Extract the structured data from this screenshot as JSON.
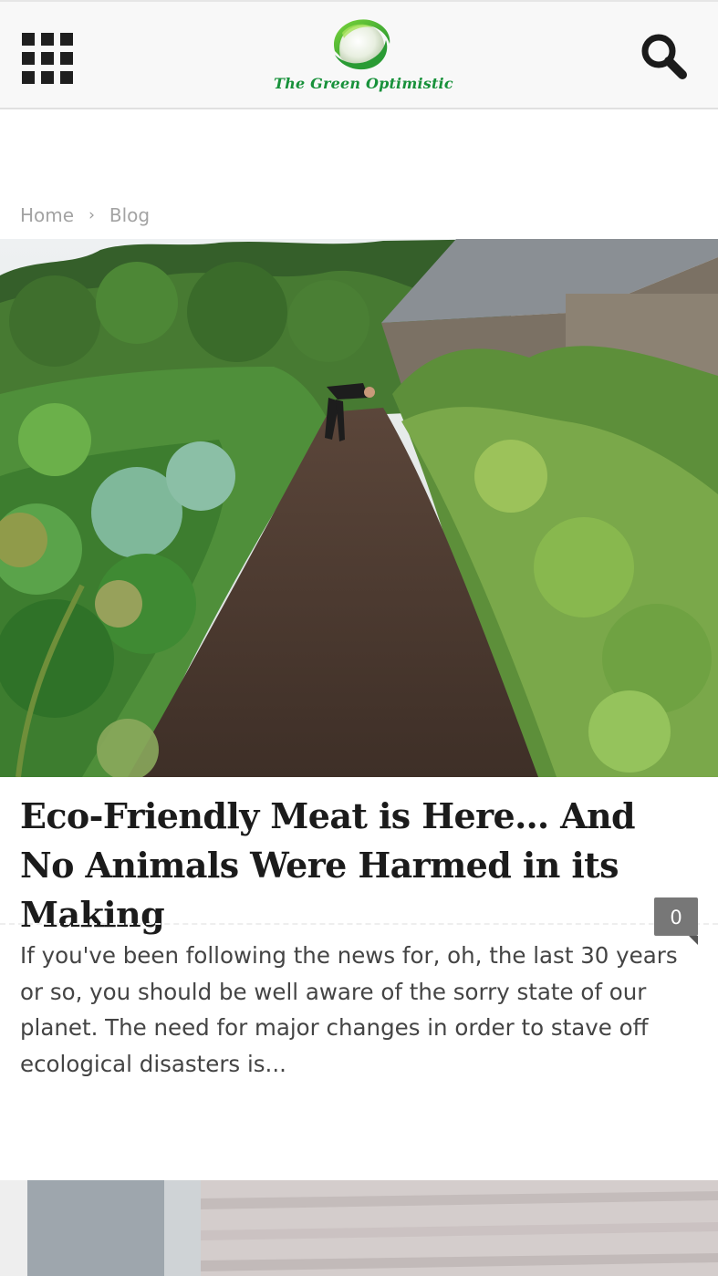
{
  "header": {
    "menu_icon": "grid-menu-icon",
    "logo_text": "The Green Optimistic",
    "search_icon": "search-icon",
    "brand_color": "#17913a"
  },
  "breadcrumb": {
    "home": "Home",
    "separator": "›",
    "current": "Blog"
  },
  "post": {
    "title": "Eco-Friendly Meat is Here… And No Animals Were Harmed in its Making",
    "comment_count": "0",
    "excerpt": "If you've been following the news for, oh, the last 30 years or so, you should be well aware of the sorry state of our planet. The need for major changes in order to stave off ecological disasters is..."
  }
}
